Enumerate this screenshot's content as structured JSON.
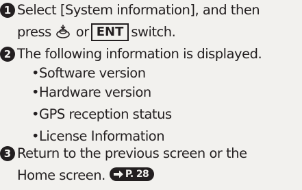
{
  "steps": [
    {
      "number": "1",
      "line1": "Select [System information], and then",
      "line2_pre": "press",
      "knob_icon": "interface-dial-icon",
      "line2_mid": "or",
      "ent_label": "ENT",
      "line2_post": "switch."
    },
    {
      "number": "2",
      "line1": "The following information is displayed.",
      "bullets": [
        "•Software version",
        "•Hardware version",
        "•GPS reception status",
        "•License Information"
      ]
    },
    {
      "number": "3",
      "line1": "Return to the previous screen or the",
      "line2": "Home screen.",
      "ref_icon": "arrow-right-icon",
      "ref_label": "P. 28"
    }
  ],
  "colors": {
    "text": "#231f20",
    "background": "#f2f1ee"
  }
}
